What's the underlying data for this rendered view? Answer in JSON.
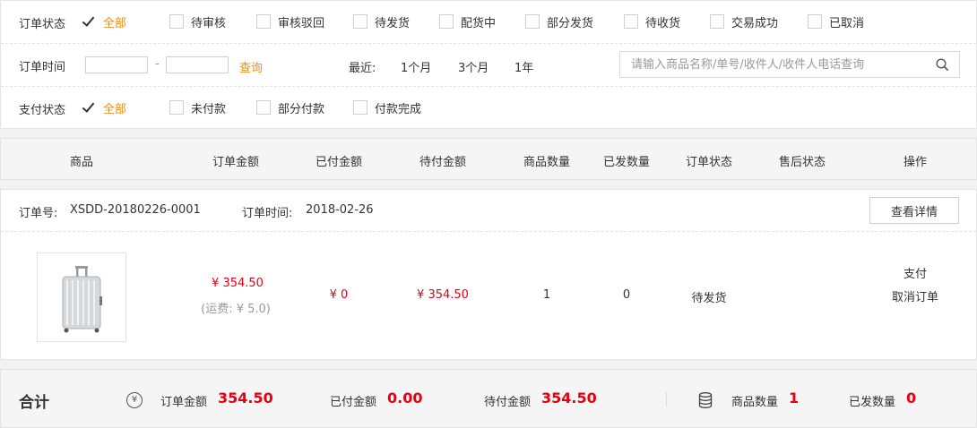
{
  "filters": {
    "order_status": {
      "label": "订单状态",
      "options": [
        {
          "label": "全部",
          "checked": true
        },
        {
          "label": "待审核",
          "checked": false
        },
        {
          "label": "审核驳回",
          "checked": false
        },
        {
          "label": "待发货",
          "checked": false
        },
        {
          "label": "配货中",
          "checked": false
        },
        {
          "label": "部分发货",
          "checked": false
        },
        {
          "label": "待收货",
          "checked": false
        },
        {
          "label": "交易成功",
          "checked": false
        },
        {
          "label": "已取消",
          "checked": false
        }
      ]
    },
    "order_time": {
      "label": "订单时间",
      "start_value": "",
      "end_value": "",
      "separator": "-",
      "query_label": "查询",
      "recent_label": "最近:",
      "recent_options": [
        "1个月",
        "3个月",
        "1年"
      ]
    },
    "search": {
      "placeholder": "请输入商品名称/单号/收件人/收件人电话查询",
      "value": ""
    },
    "pay_status": {
      "label": "支付状态",
      "options": [
        {
          "label": "全部",
          "checked": true
        },
        {
          "label": "未付款",
          "checked": false
        },
        {
          "label": "部分付款",
          "checked": false
        },
        {
          "label": "付款完成",
          "checked": false
        }
      ]
    }
  },
  "table_header": [
    "商品",
    "订单金额",
    "已付金额",
    "待付金额",
    "商品数量",
    "已发数量",
    "订单状态",
    "售后状态",
    "操作"
  ],
  "order": {
    "number_label": "订单号:",
    "number": "XSDD-20180226-0001",
    "time_label": "订单时间:",
    "time": "2018-02-26",
    "detail_button": "查看详情",
    "amount": "¥ 354.50",
    "shipping": "(运费: ¥ 5.0)",
    "paid": "¥ 0",
    "pending": "¥ 354.50",
    "quantity": "1",
    "shipped": "0",
    "status": "待发货",
    "after_sale": "",
    "actions": [
      "支付",
      "取消订单"
    ]
  },
  "summary": {
    "title": "合计",
    "currency_icon": "yen-circle-icon",
    "order_amount_label": "订单金额",
    "order_amount": "354.50",
    "paid_label": "已付金额",
    "paid": "0.00",
    "pending_label": "待付金额",
    "pending": "354.50",
    "quantity_icon": "database-icon",
    "quantity_label": "商品数量",
    "quantity": "1",
    "shipped_label": "已发数量",
    "shipped": "0"
  },
  "colors": {
    "accent_orange": "#f08c1e",
    "price_red": "#e60012"
  }
}
